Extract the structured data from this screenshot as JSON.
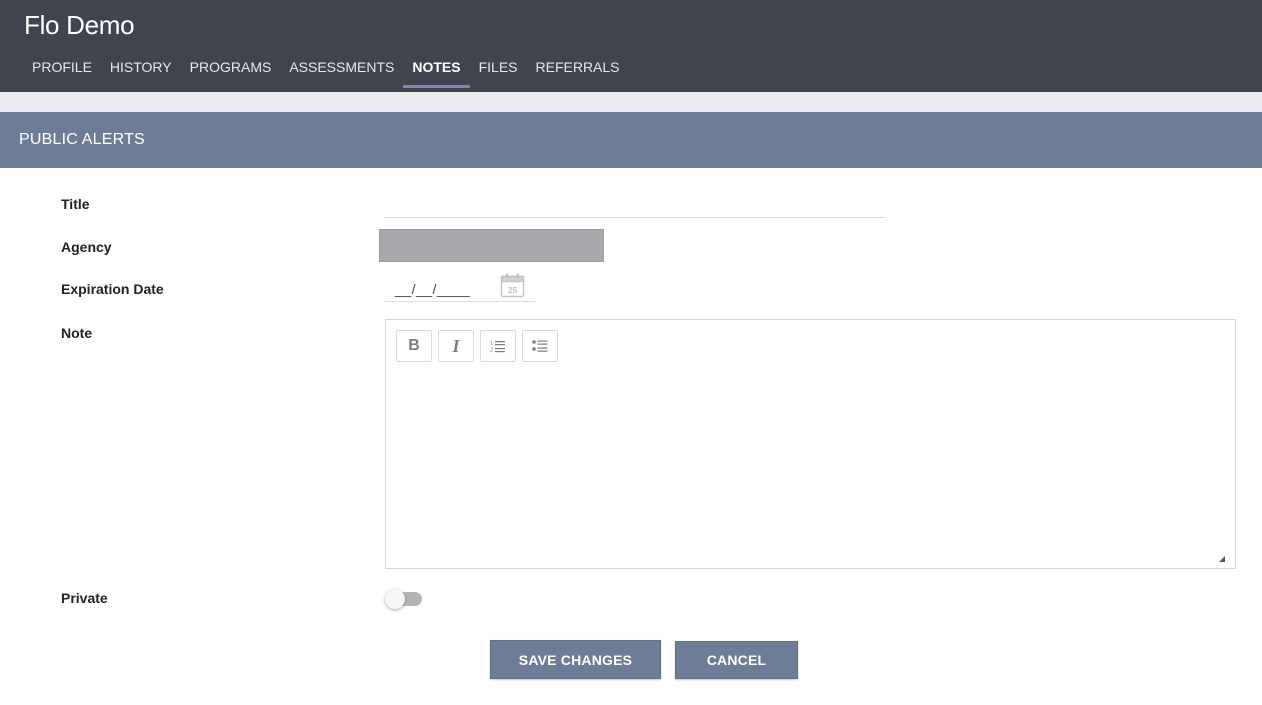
{
  "app": {
    "title": "Flo Demo"
  },
  "tabs": [
    {
      "label": "PROFILE",
      "active": false
    },
    {
      "label": "HISTORY",
      "active": false
    },
    {
      "label": "PROGRAMS",
      "active": false
    },
    {
      "label": "ASSESSMENTS",
      "active": false
    },
    {
      "label": "NOTES",
      "active": true
    },
    {
      "label": "FILES",
      "active": false
    },
    {
      "label": "REFERRALS",
      "active": false
    }
  ],
  "section": {
    "title": "PUBLIC ALERTS"
  },
  "form": {
    "title_label": "Title",
    "title_value": "",
    "agency_label": "Agency",
    "agency_value": "",
    "expiration_label": "Expiration Date",
    "expiration_mask": "__/__/____",
    "calendar_day": "25",
    "note_label": "Note",
    "note_value": "",
    "toolbar": {
      "bold": {
        "glyph": "B",
        "icon": "bold-icon"
      },
      "italic": {
        "glyph": "I",
        "icon": "italic-icon"
      },
      "ordered_list": {
        "icon": "ordered-list-icon"
      },
      "unordered_list": {
        "icon": "unordered-list-icon"
      }
    },
    "private_label": "Private",
    "private_on": false
  },
  "actions": {
    "save_label": "SAVE CHANGES",
    "cancel_label": "CANCEL"
  },
  "colors": {
    "topbar": "#41444e",
    "section_header": "#6d7d96",
    "button": "#6d7d96",
    "active_tab_underline": "#7d8aa6"
  }
}
